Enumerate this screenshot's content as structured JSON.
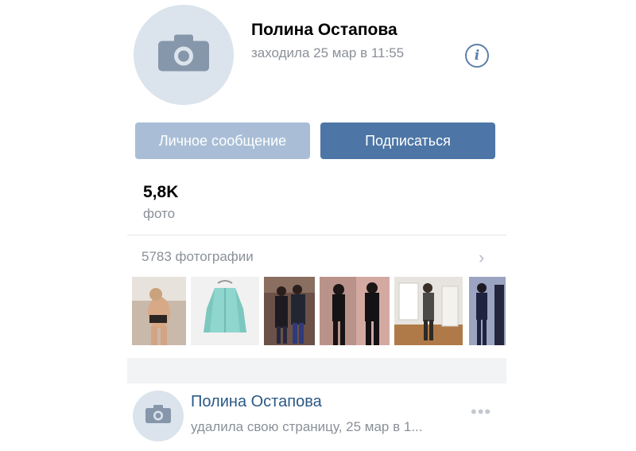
{
  "profile": {
    "name": "Полина Остапова",
    "last_seen": "заходила 25 мар в 11:55",
    "info_icon_glyph": "i"
  },
  "actions": {
    "message_label": "Личное сообщение",
    "subscribe_label": "Подписаться"
  },
  "counters": {
    "photos_value": "5,8K",
    "photos_label": "фото"
  },
  "photos": {
    "header": "5783 фотографии",
    "chevron": "›"
  },
  "post": {
    "author": "Полина Остапова",
    "text": "удалила свою страницу, 25 мар в 1...",
    "menu": "•••"
  },
  "colors": {
    "primary_button": "#4d76a6",
    "secondary_button": "#a9bed6",
    "link": "#2a5885",
    "muted_text": "#8a9098"
  }
}
